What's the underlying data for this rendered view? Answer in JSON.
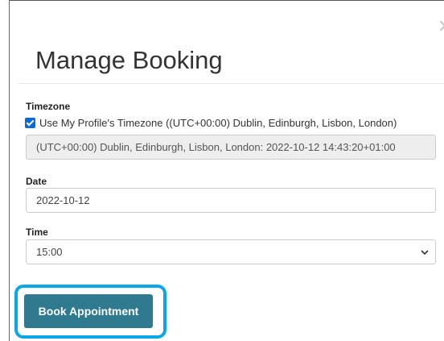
{
  "modal": {
    "title": "Manage Booking",
    "close_icon": "close-icon"
  },
  "timezone": {
    "label": "Timezone",
    "use_profile_checked": true,
    "use_profile_label": "Use My Profile's Timezone ((UTC+00:00) Dublin, Edinburgh, Lisbon, London)",
    "display_value": "(UTC+00:00) Dublin, Edinburgh, Lisbon, London: 2022-10-12 14:43:20+01:00"
  },
  "date": {
    "label": "Date",
    "value": "2022-10-12"
  },
  "time": {
    "label": "Time",
    "value": "15:00",
    "dropdown_icon": "chevron-down-icon"
  },
  "actions": {
    "book_label": "Book Appointment"
  },
  "colors": {
    "button": "#2f7a8f",
    "highlight": "#0aa6e8",
    "checkbox": "#0b69d6"
  }
}
